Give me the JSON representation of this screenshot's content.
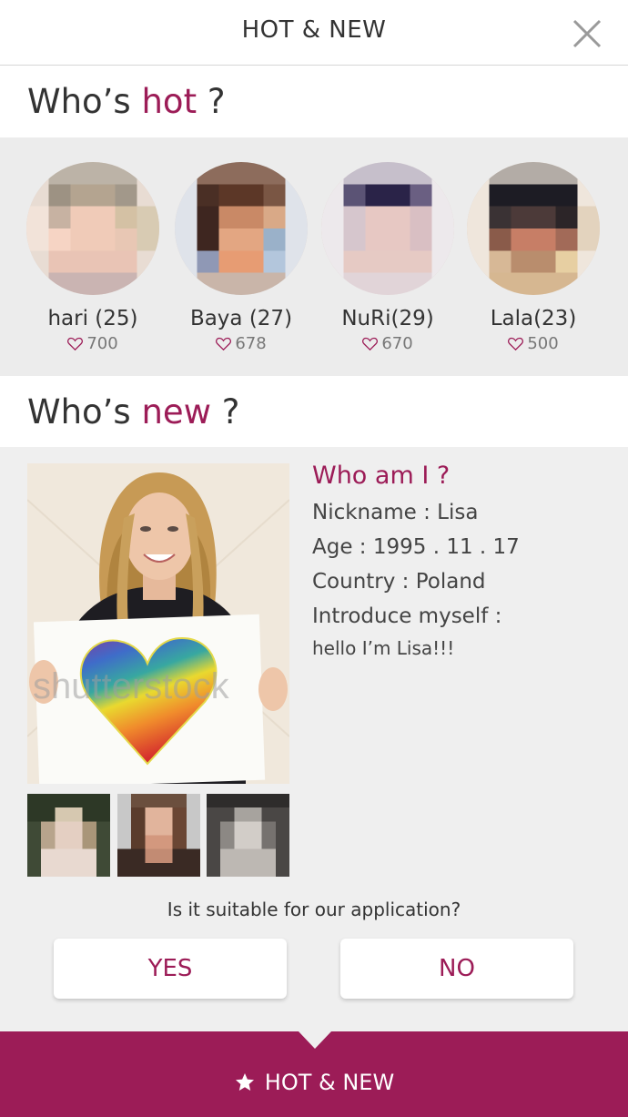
{
  "header": {
    "title": "HOT & NEW",
    "close_icon": "close-icon"
  },
  "hot_section": {
    "heading_prefix": "Who’s ",
    "heading_accent": "hot",
    "heading_suffix": " ?",
    "users": [
      {
        "name": "hari (25)",
        "likes": "700"
      },
      {
        "name": "Baya (27)",
        "likes": "678"
      },
      {
        "name": "NuRi(29)",
        "likes": "670"
      },
      {
        "name": "Lala(23)",
        "likes": "500"
      }
    ]
  },
  "new_section": {
    "heading_prefix": "Who’s ",
    "heading_accent": "new",
    "heading_suffix": " ?",
    "profile": {
      "title": "Who am I ?",
      "nickname": "Nickname : Lisa",
      "age": "Age : 1995 . 11 . 17",
      "country": "Country : Poland",
      "introduce_label": "Introduce myself :",
      "introduce_text": "hello I’m Lisa!!!",
      "photo_watermark": "shutterstock"
    },
    "question": "Is it suitable for our application?",
    "yes_label": "YES",
    "no_label": "NO"
  },
  "bottom_nav": {
    "label": "HOT & NEW",
    "icon": "star-icon"
  },
  "colors": {
    "accent": "#9c1c57",
    "background": "#efefef"
  }
}
